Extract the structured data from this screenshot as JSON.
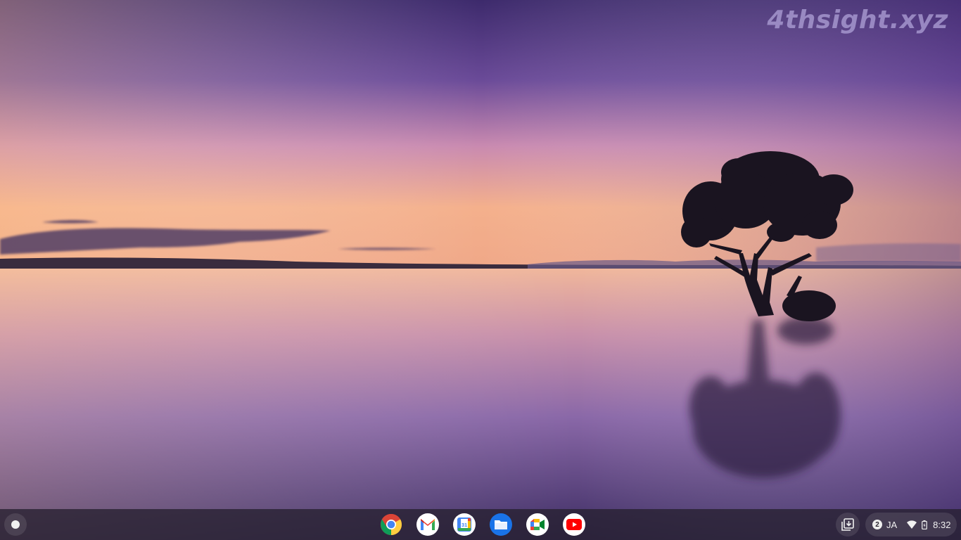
{
  "wallpaper": {
    "watermark": "4thsight.xyz"
  },
  "shelf": {
    "launcher_icon": "launcher-circle-icon",
    "apps": [
      {
        "name": "chrome",
        "icon": "chrome-icon"
      },
      {
        "name": "gmail",
        "icon": "gmail-icon"
      },
      {
        "name": "calendar",
        "icon": "calendar-icon",
        "label": "31"
      },
      {
        "name": "files",
        "icon": "files-folder-icon"
      },
      {
        "name": "meet",
        "icon": "meet-icon"
      },
      {
        "name": "youtube",
        "icon": "youtube-icon"
      }
    ],
    "holding_space_icon": "holding-space-icon",
    "tray": {
      "notification_count": "2",
      "ime": "JA",
      "wifi_icon": "wifi-icon",
      "battery_icon": "battery-icon",
      "time": "8:32"
    }
  },
  "colors": {
    "sky_top": "#3a2a6a",
    "sky_mid": "#9a6ab0",
    "horizon": "#f3b48a",
    "shelf_bg": "#262030"
  }
}
